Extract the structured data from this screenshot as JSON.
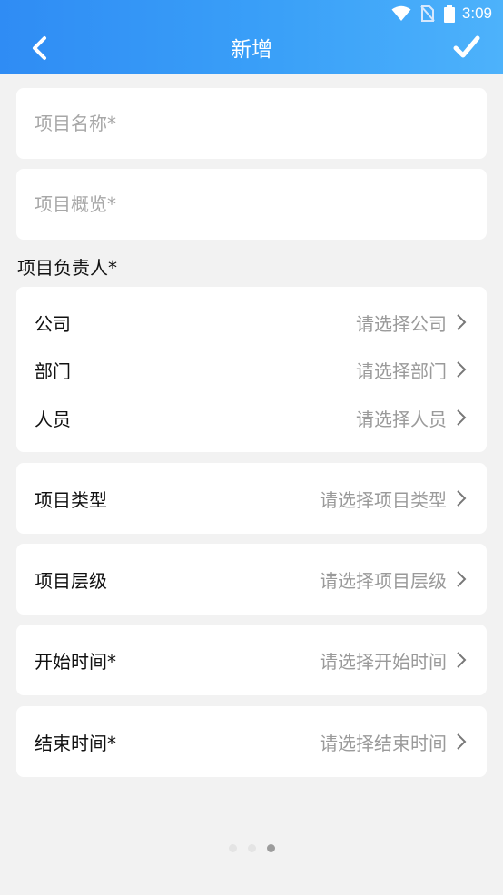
{
  "status_bar": {
    "time": "3:09",
    "icons": [
      "wifi-icon",
      "no-sim-icon",
      "battery-icon"
    ]
  },
  "header": {
    "title": "新增",
    "back_icon": "chevron-left-icon",
    "confirm_icon": "checkmark-icon",
    "gradient_colors": [
      "#2f8cf4",
      "#4db2fb"
    ]
  },
  "form": {
    "project_name_placeholder": "项目名称*",
    "project_overview_placeholder": "项目概览*",
    "owner_section_label": "项目负责人*",
    "owner": {
      "company": {
        "label": "公司",
        "placeholder": "请选择公司"
      },
      "department": {
        "label": "部门",
        "placeholder": "请选择部门"
      },
      "person": {
        "label": "人员",
        "placeholder": "请选择人员"
      }
    },
    "project_type": {
      "label": "项目类型",
      "placeholder": "请选择项目类型"
    },
    "project_level": {
      "label": "项目层级",
      "placeholder": "请选择项目层级"
    },
    "start_time": {
      "label": "开始时间*",
      "placeholder": "请选择开始时间"
    },
    "end_time": {
      "label": "结束时间*",
      "placeholder": "请选择结束时间"
    }
  },
  "pager": {
    "count": 3,
    "active_index": 2
  }
}
